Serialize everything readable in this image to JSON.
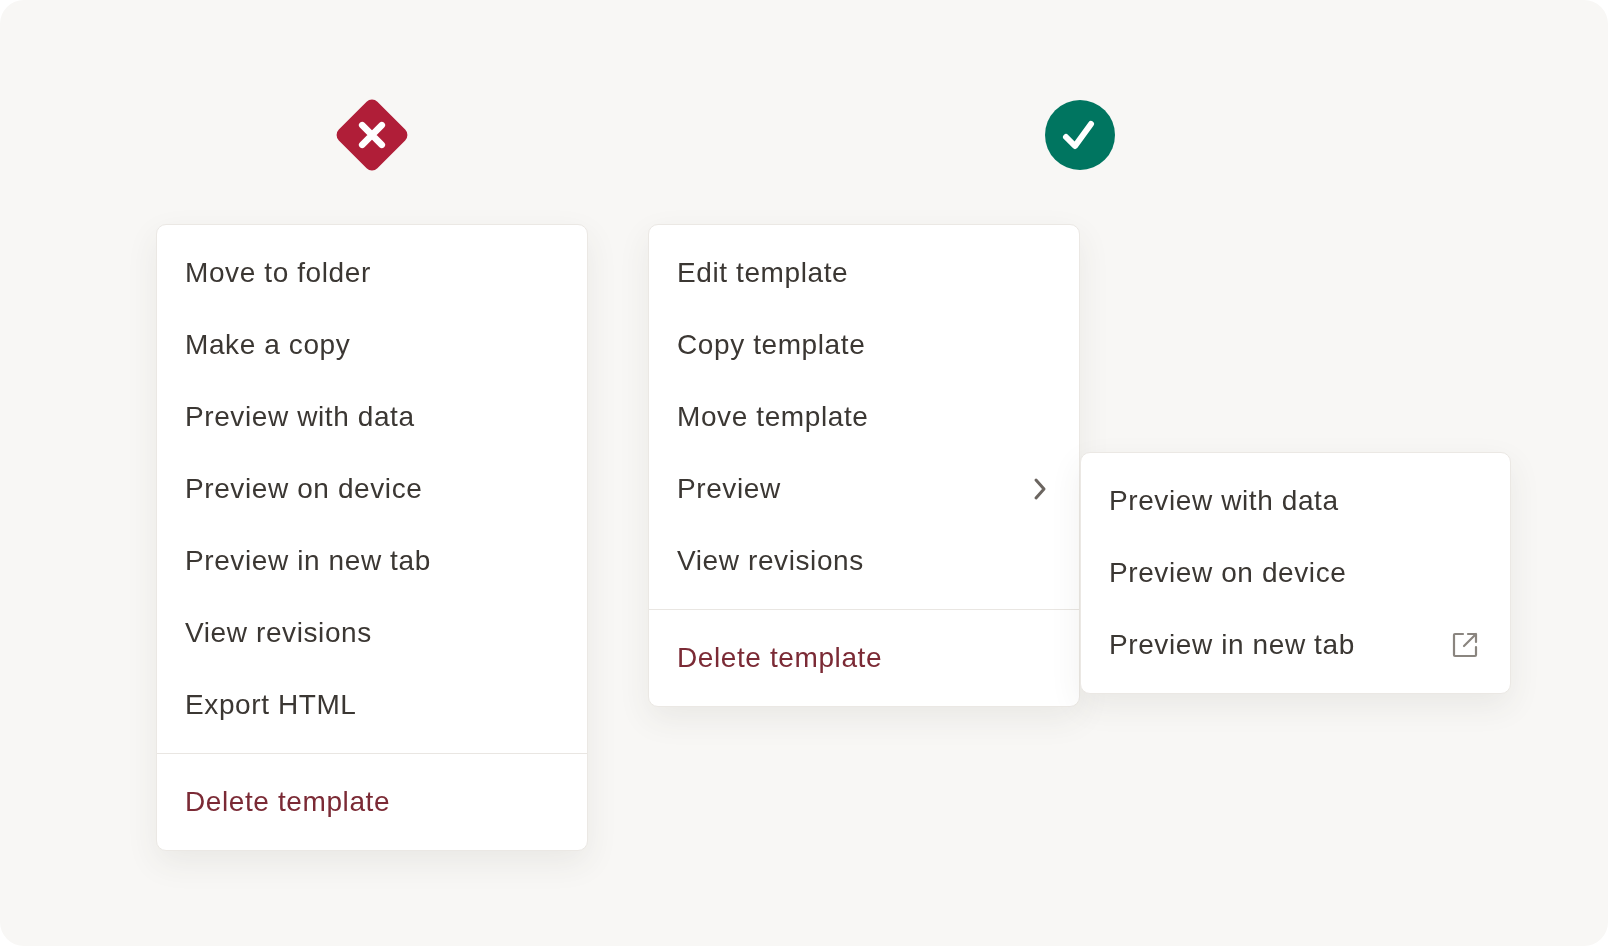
{
  "examples": [
    {
      "kind": "bad",
      "sections": [
        {
          "items": [
            {
              "label": "Move to folder",
              "kind": "plain"
            },
            {
              "label": "Make a copy",
              "kind": "plain"
            },
            {
              "label": "Preview with data",
              "kind": "plain"
            },
            {
              "label": "Preview on device",
              "kind": "plain"
            },
            {
              "label": "Preview in new tab",
              "kind": "plain"
            },
            {
              "label": "View revisions",
              "kind": "plain"
            },
            {
              "label": "Export HTML",
              "kind": "plain"
            }
          ]
        },
        {
          "items": [
            {
              "label": "Delete template",
              "kind": "danger"
            }
          ]
        }
      ]
    },
    {
      "kind": "good",
      "sections": [
        {
          "items": [
            {
              "label": "Edit template",
              "kind": "plain"
            },
            {
              "label": "Copy template",
              "kind": "plain"
            },
            {
              "label": "Move template",
              "kind": "plain"
            },
            {
              "label": "Preview",
              "kind": "submenu",
              "expanded": true,
              "children": [
                {
                  "label": "Preview with data",
                  "kind": "plain"
                },
                {
                  "label": "Preview on device",
                  "kind": "plain"
                },
                {
                  "label": "Preview in new tab",
                  "kind": "external"
                }
              ]
            },
            {
              "label": "View revisions",
              "kind": "plain"
            }
          ]
        },
        {
          "items": [
            {
              "label": "Delete template",
              "kind": "danger"
            }
          ]
        }
      ]
    }
  ]
}
